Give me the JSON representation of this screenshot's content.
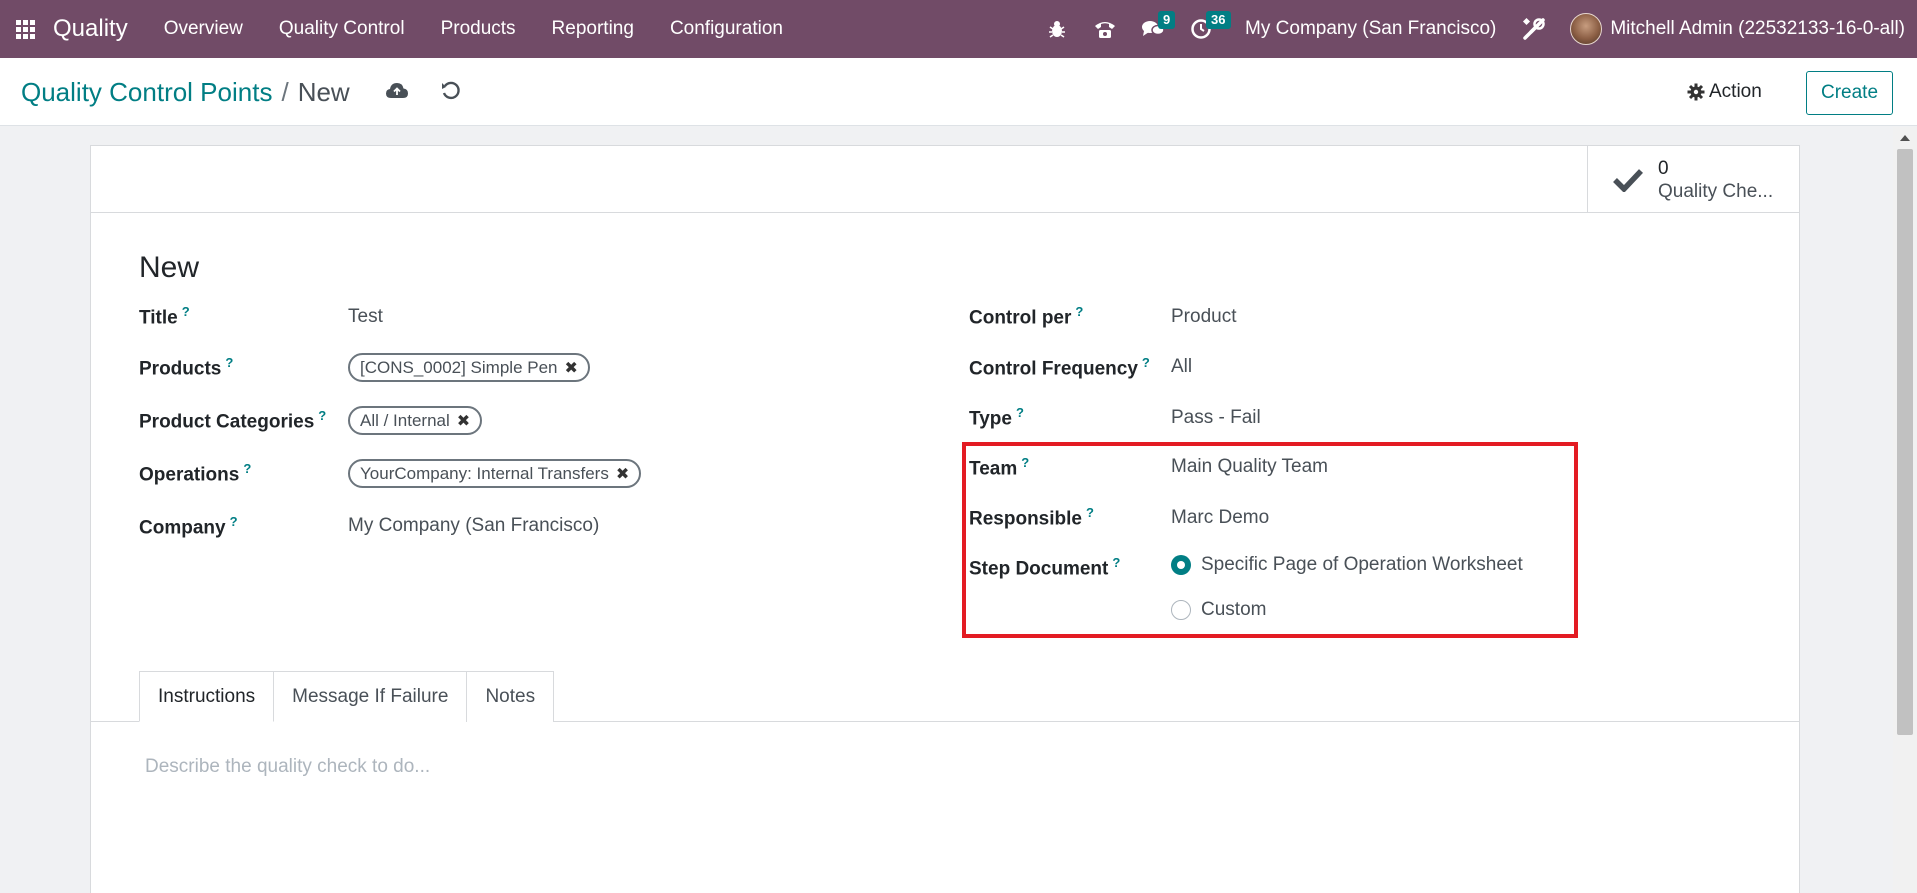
{
  "navbar": {
    "brand": "Quality",
    "menu": [
      "Overview",
      "Quality Control",
      "Products",
      "Reporting",
      "Configuration"
    ],
    "messages_count": "9",
    "activities_count": "36",
    "company": "My Company (San Francisco)",
    "user": "Mitchell Admin (22532133-16-0-all)"
  },
  "breadcrumb": {
    "parent": "Quality Control Points",
    "separator": "/",
    "current": "New"
  },
  "control_panel": {
    "action_label": "Action",
    "create_label": "Create"
  },
  "stat_button": {
    "count": "0",
    "label": "Quality Che..."
  },
  "form": {
    "record_title": "New",
    "help_mark": "?",
    "title": {
      "label": "Title",
      "value": "Test"
    },
    "products": {
      "label": "Products",
      "tags": [
        "[CONS_0002] Simple Pen"
      ]
    },
    "product_categories": {
      "label": "Product Categories",
      "tags": [
        "All / Internal"
      ]
    },
    "operations": {
      "label": "Operations",
      "tags": [
        "YourCompany: Internal Transfers"
      ]
    },
    "company": {
      "label": "Company",
      "value": "My Company (San Francisco)"
    },
    "control_per": {
      "label": "Control per",
      "value": "Product"
    },
    "control_frequency": {
      "label": "Control Frequency",
      "value": "All"
    },
    "type": {
      "label": "Type",
      "value": "Pass - Fail"
    },
    "team": {
      "label": "Team",
      "value": "Main Quality Team"
    },
    "responsible": {
      "label": "Responsible",
      "value": "Marc Demo"
    },
    "step_document": {
      "label": "Step Document",
      "options": [
        "Specific Page of Operation Worksheet",
        "Custom"
      ],
      "selected": "Specific Page of Operation Worksheet"
    }
  },
  "tabs": [
    "Instructions",
    "Message If Failure",
    "Notes"
  ],
  "active_tab": "Instructions",
  "instructions_placeholder": "Describe the quality check to do...",
  "colors": {
    "navbar": "#714b67",
    "accent": "#017e84",
    "highlight": "#e31b23"
  }
}
